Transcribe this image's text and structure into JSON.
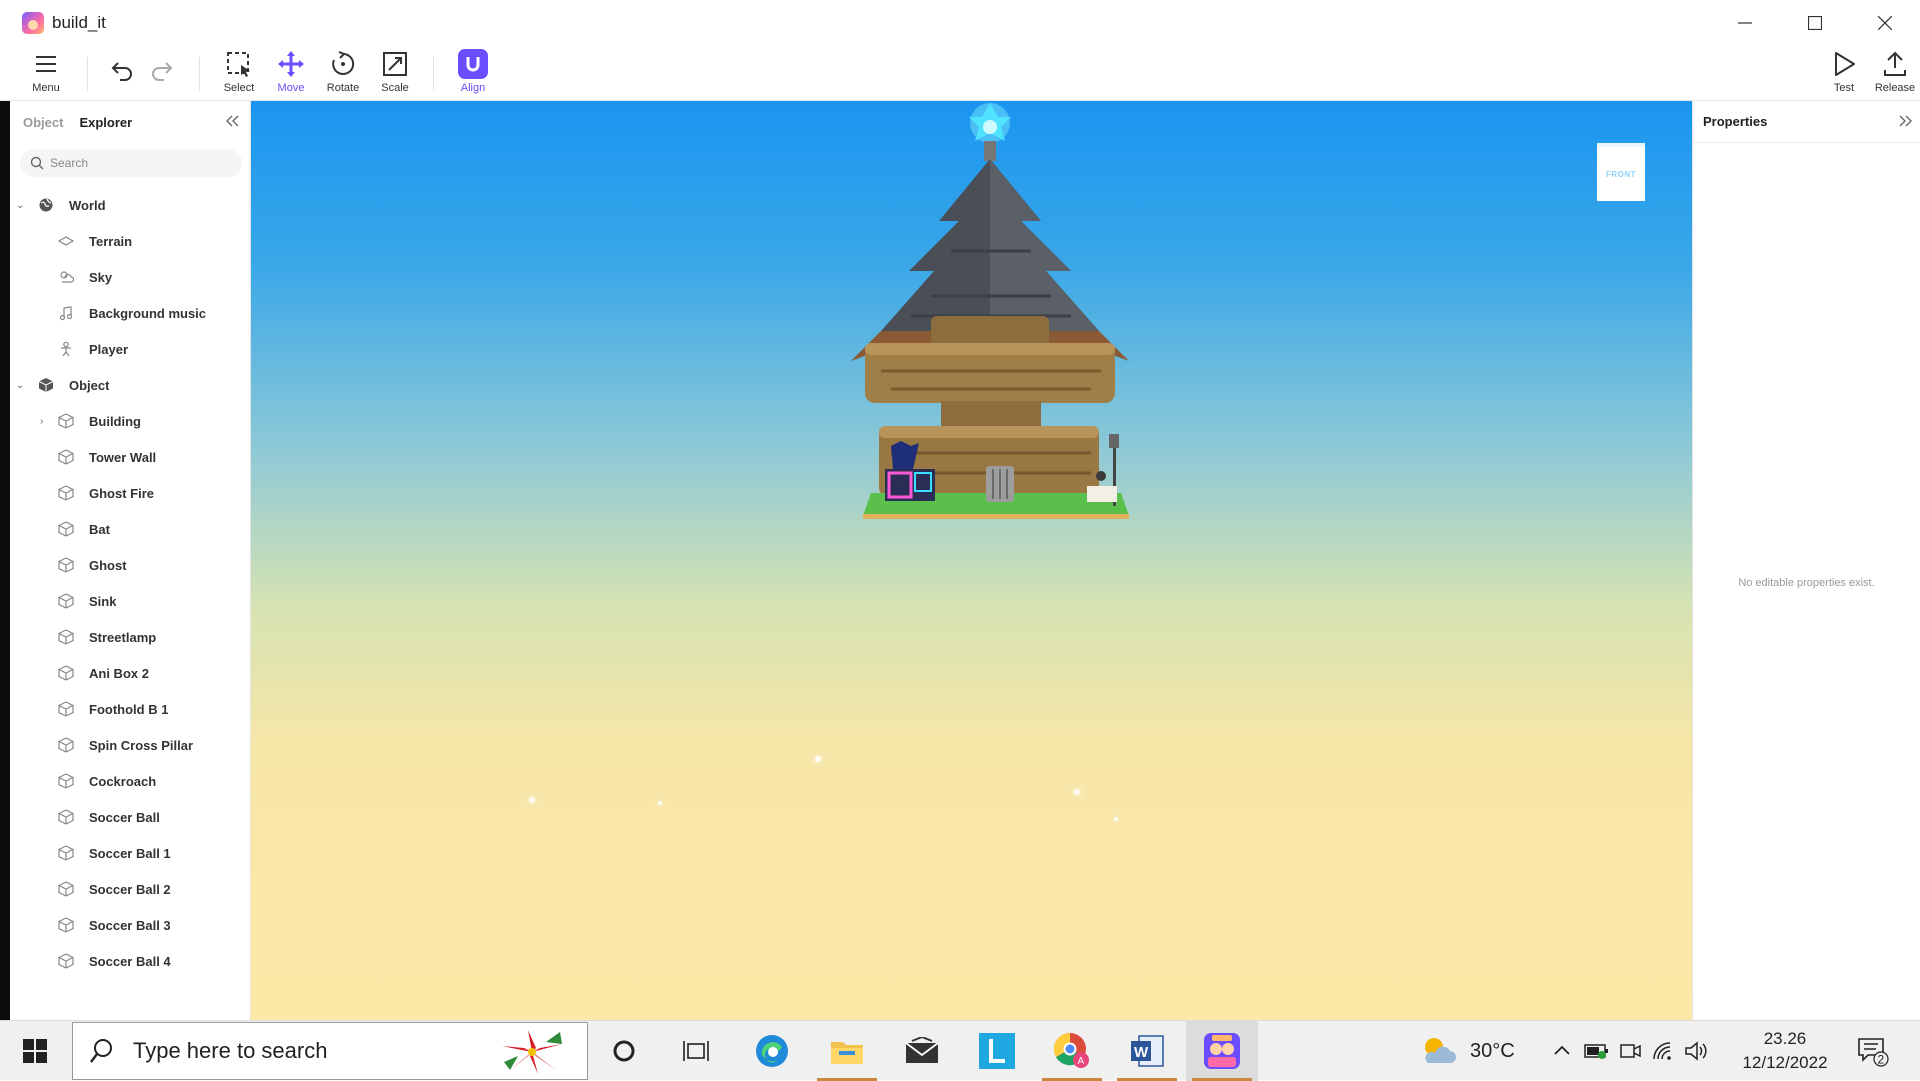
{
  "window": {
    "title": "build_it"
  },
  "toolbar": {
    "menu": "Menu",
    "select": "Select",
    "move": "Move",
    "rotate": "Rotate",
    "scale": "Scale",
    "align": "Align",
    "test": "Test",
    "release": "Release",
    "accent_color": "#6c4cff"
  },
  "explorer": {
    "tabs": [
      "Object",
      "Explorer"
    ],
    "active_tab": "Explorer",
    "search_placeholder": "Search",
    "world": {
      "label": "World",
      "items": [
        "Terrain",
        "Sky",
        "Background music",
        "Player"
      ]
    },
    "object": {
      "label": "Object",
      "items": [
        "Building",
        "Tower Wall",
        "Ghost Fire",
        "Bat",
        "Ghost",
        "Sink",
        "Streetlamp",
        "Ani Box 2",
        "Foothold B 1",
        "Spin Cross Pillar",
        "Cockroach",
        "Soccer Ball",
        "Soccer Ball 1",
        "Soccer Ball 2",
        "Soccer Ball 3",
        "Soccer Ball 4"
      ]
    }
  },
  "viewport": {
    "orientation_cube_label": "FRONT"
  },
  "properties": {
    "title": "Properties",
    "empty_message": "No editable properties exist."
  },
  "taskbar": {
    "search_placeholder": "Type here to search",
    "weather_temp": "30°C",
    "time": "23.26",
    "date": "12/12/2022",
    "notification_count": "2",
    "apps": [
      "cortana-icon",
      "task-view-icon",
      "edge-icon",
      "file-explorer-icon",
      "mail-icon",
      "l-app-icon",
      "chrome-icon",
      "word-icon",
      "build-it-icon"
    ]
  }
}
